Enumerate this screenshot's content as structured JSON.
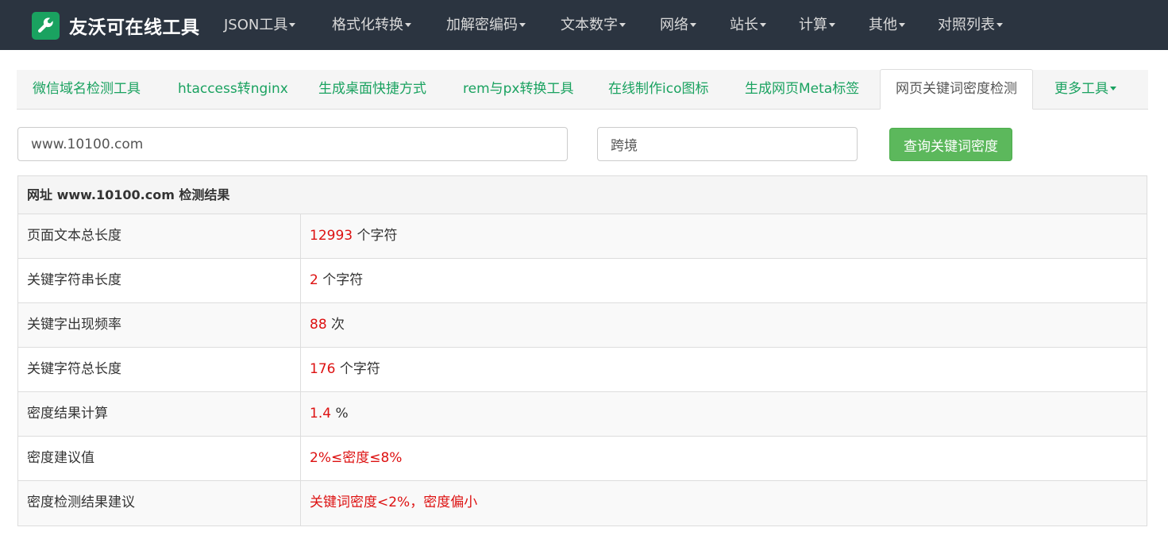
{
  "brand": {
    "title": "友沃可在线工具"
  },
  "nav": [
    {
      "label": "JSON工具"
    },
    {
      "label": "格式化转换"
    },
    {
      "label": "加解密编码"
    },
    {
      "label": "文本数字"
    },
    {
      "label": "网络"
    },
    {
      "label": "站长"
    },
    {
      "label": "计算"
    },
    {
      "label": "其他"
    },
    {
      "label": "对照列表"
    }
  ],
  "tabs": [
    {
      "label": "微信域名检测工具"
    },
    {
      "label": "htaccess转nginx"
    },
    {
      "label": "生成桌面快捷方式"
    },
    {
      "label": "rem与px转换工具"
    },
    {
      "label": "在线制作ico图标"
    },
    {
      "label": "生成网页Meta标签"
    },
    {
      "label": "网页关键词密度检测",
      "active": true
    },
    {
      "label": "更多工具"
    }
  ],
  "form": {
    "url_value": "www.10100.com",
    "keyword_value": "跨境",
    "submit_label": "查询关键词密度"
  },
  "result": {
    "header": "网址 www.10100.com 检测结果",
    "rows": [
      {
        "label": "页面文本总长度",
        "value": "12993",
        "unit": " 个字符"
      },
      {
        "label": "关键字符串长度",
        "value": "2",
        "unit": " 个字符"
      },
      {
        "label": "关键字出现频率",
        "value": "88",
        "unit": " 次"
      },
      {
        "label": "关键字符总长度",
        "value": "176",
        "unit": " 个字符"
      },
      {
        "label": "密度结果计算",
        "value": "1.4",
        "unit": " %"
      },
      {
        "label": "密度建议值",
        "value": "2%≤密度≤8%",
        "unit": ""
      },
      {
        "label": "密度检测结果建议",
        "value": "关键词密度<2%，密度偏小",
        "unit": ""
      }
    ]
  },
  "colors": {
    "navbar_bg": "#2b3440",
    "brand_green": "#1aa260",
    "button_green": "#5cb85c",
    "highlight_red": "#dd1111"
  },
  "icons": {
    "brand": "wrench-icon",
    "dropdown": "caret-down-icon"
  }
}
